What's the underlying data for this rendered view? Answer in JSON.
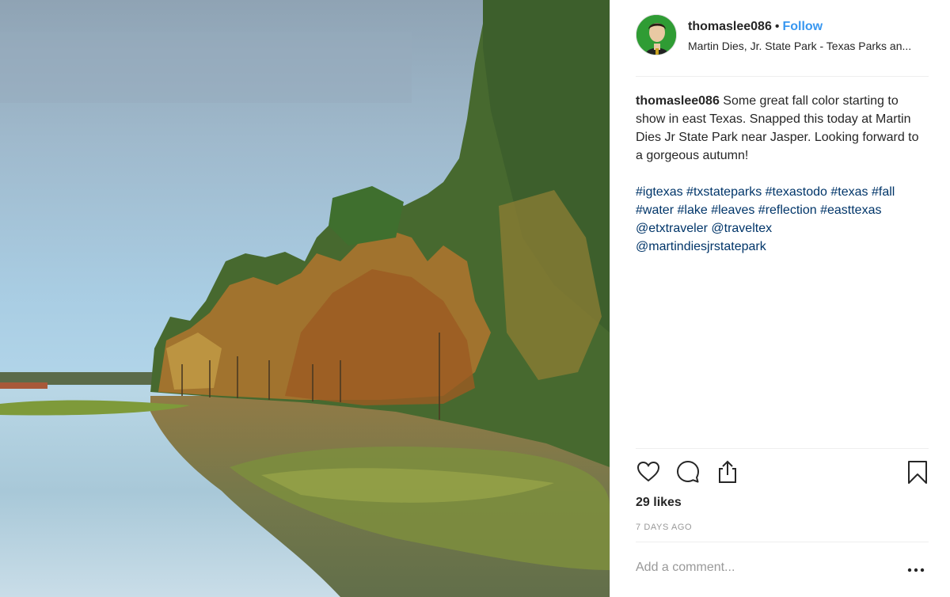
{
  "post": {
    "username": "thomaslee086",
    "separator": "•",
    "follow_label": "Follow",
    "location": "Martin Dies, Jr. State Park - Texas Parks an...",
    "caption_user": "thomaslee086",
    "caption_text": "Some great fall color starting to show in east Texas. Snapped this today at Martin Dies Jr State Park near Jasper. Looking forward to a gorgeous autumn!",
    "tags": [
      "#igtexas",
      "#txstateparks",
      "#texastodo",
      "#texas",
      "#fall",
      "#water",
      "#lake",
      "#leaves",
      "#reflection",
      "#easttexas",
      "@etxtraveler",
      "@traveltex",
      "@martindiesjrstatepark"
    ],
    "likes": "29 likes",
    "time": "7 DAYS AGO",
    "comment_placeholder": "Add a comment..."
  },
  "icons": {
    "like": "heart-icon",
    "comment": "comment-bubble-icon",
    "share": "share-icon",
    "save": "bookmark-icon",
    "more": "more-dots-icon"
  },
  "colors": {
    "follow": "#3897f0",
    "hashtag": "#003569",
    "muted": "#999999",
    "text": "#262626"
  }
}
